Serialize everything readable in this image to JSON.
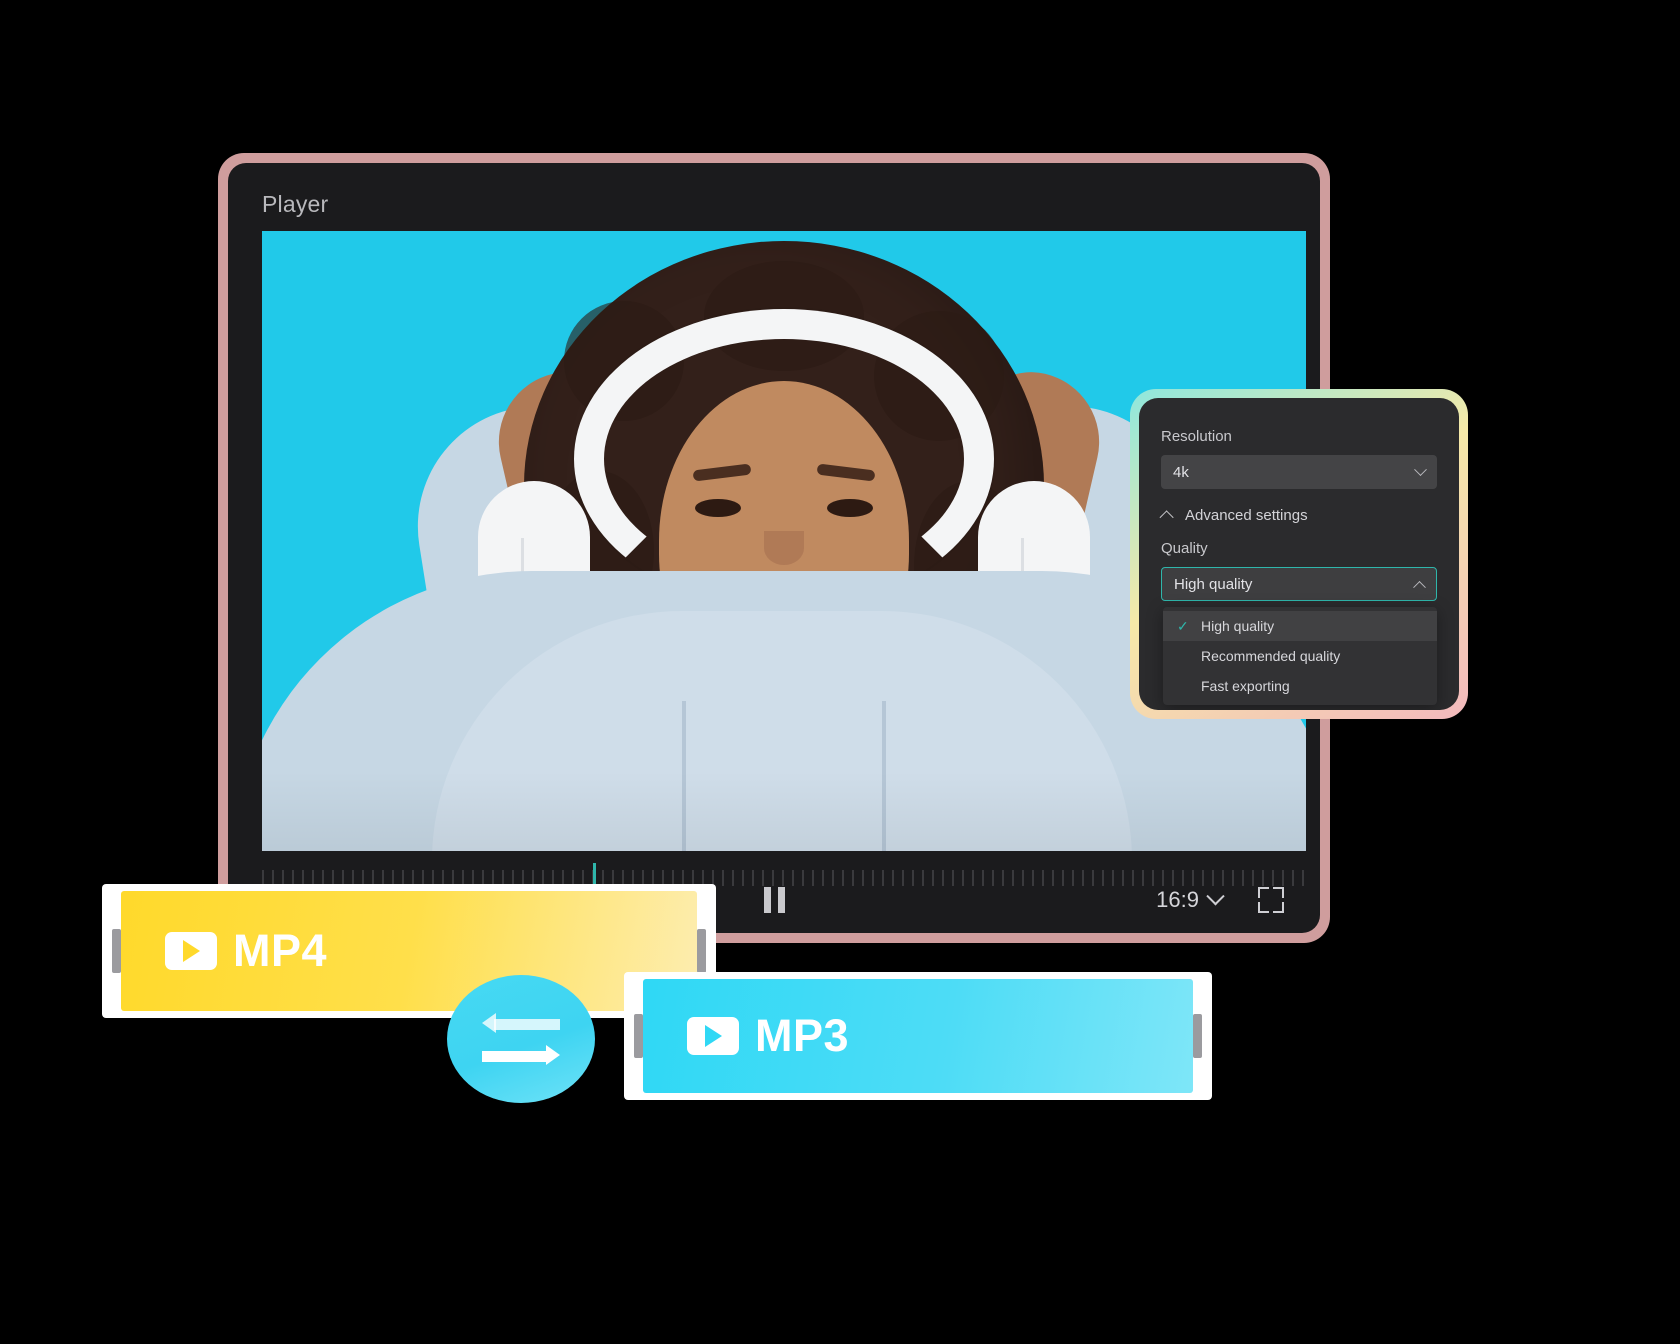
{
  "player": {
    "title": "Player",
    "controls": {
      "pause_label": "Pause",
      "aspect_ratio": "16:9",
      "fullscreen_label": "Fullscreen"
    }
  },
  "settings": {
    "resolution_label": "Resolution",
    "resolution_value": "4k",
    "advanced_label": "Advanced settings",
    "quality_label": "Quality",
    "quality_value": "High quality",
    "quality_options": [
      {
        "label": "High quality",
        "selected": true
      },
      {
        "label": "Recommended quality",
        "selected": false
      },
      {
        "label": "Fast exporting",
        "selected": false
      }
    ],
    "check_glyph": "✓"
  },
  "clips": {
    "source": {
      "format": "MP4",
      "color": "#ffd92b"
    },
    "target": {
      "format": "MP3",
      "color": "#2fd8f5"
    },
    "swap_label": "Convert"
  },
  "colors": {
    "accent_teal": "#2fb6ab",
    "frame_pink": "#cf9d9d",
    "panel_dark": "#2b2b2d",
    "video_bg": "#21c9e9",
    "mp4_yellow": "#ffd92b",
    "mp3_cyan": "#2fd8f5"
  }
}
